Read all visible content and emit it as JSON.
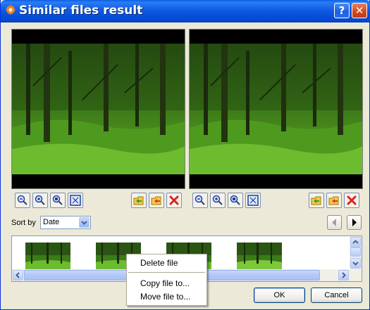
{
  "window": {
    "title": "Similar files result"
  },
  "titlebar_buttons": {
    "help_label": "?",
    "close_label": "✕"
  },
  "left_toolbar": [
    "zoom-out-icon",
    "zoom-in-icon",
    "zoom-actual-icon",
    "fit-window-icon",
    "open-folder-icon",
    "copy-folder-icon",
    "delete-icon"
  ],
  "right_toolbar": [
    "zoom-out-icon",
    "zoom-in-icon",
    "zoom-actual-icon",
    "fit-window-icon",
    "open-folder-icon",
    "copy-folder-icon",
    "delete-icon"
  ],
  "sort": {
    "label": "Sort by",
    "value": "Date"
  },
  "context_menu": {
    "items": [
      "Delete file",
      "Copy file to...",
      "Move file to..."
    ]
  },
  "buttons": {
    "ok": "OK",
    "cancel": "Cancel"
  },
  "colors": {
    "titlebar": "#0A5FE6",
    "window_bg": "#ECE9D8",
    "delete": "#E02020"
  }
}
